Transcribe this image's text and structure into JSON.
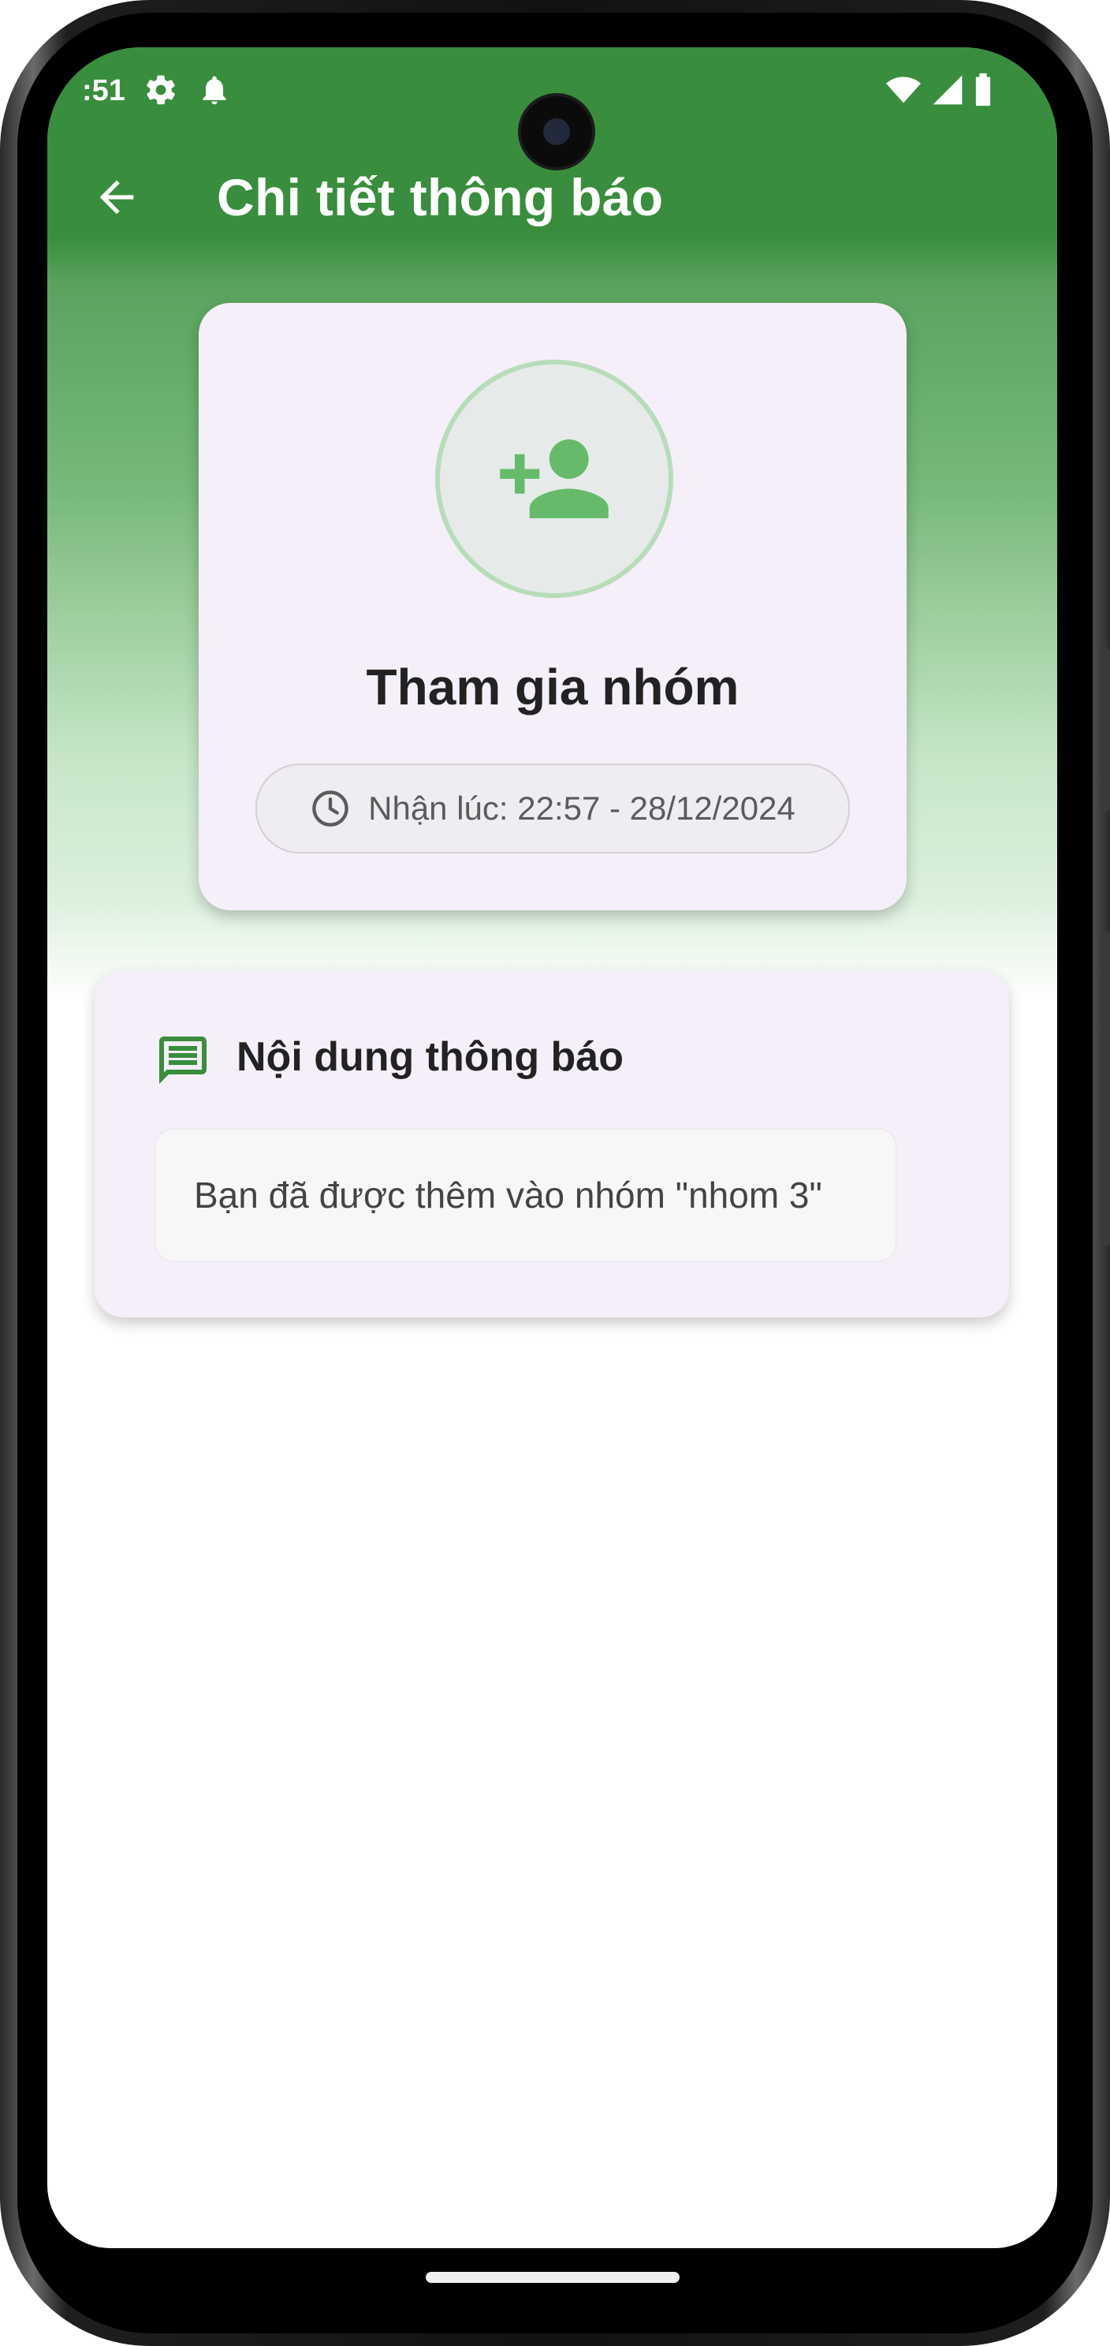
{
  "status_bar": {
    "time": ":51",
    "icons": [
      "gear-icon",
      "bell-icon",
      "wifi-icon",
      "signal-icon",
      "battery-icon"
    ]
  },
  "app_bar": {
    "title": "Chi tiết thông báo",
    "back_icon": "arrow-left-icon"
  },
  "notification": {
    "type_icon": "person-add-icon",
    "type_label": "Tham gia nhóm",
    "received_label": "Nhận lúc: 22:57 - 28/12/2024",
    "clock_icon": "clock-icon"
  },
  "content_section": {
    "icon": "message-icon",
    "title": "Nội dung thông báo",
    "message": "Bạn đã được thêm vào nhóm \"nhom 3\""
  },
  "colors": {
    "primary": "#388e3c",
    "accent_light": "#66bb6a",
    "card_bg": "#f4eff8"
  }
}
